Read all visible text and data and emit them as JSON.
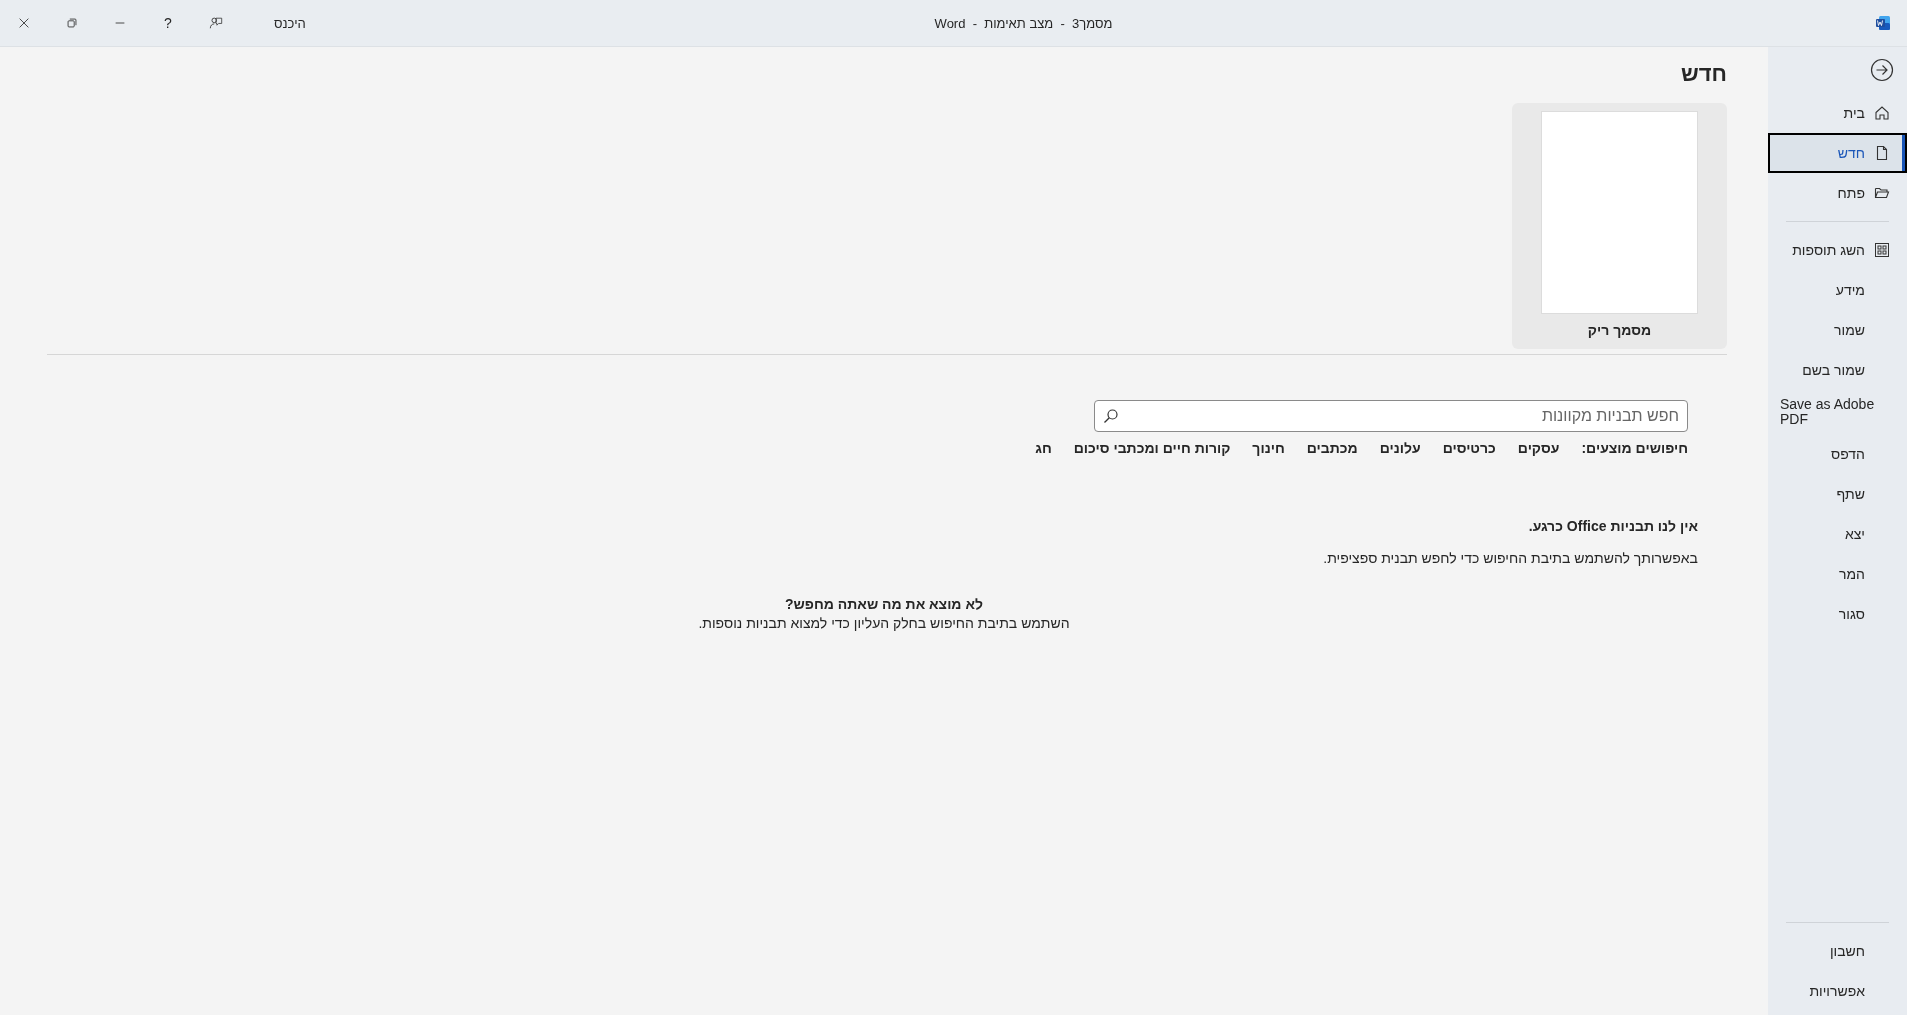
{
  "title_bar": {
    "title": "מסמך3  -  מצב תאימות  -  Word",
    "sign_in": "היכנס",
    "help": "?"
  },
  "sidebar": {
    "top_items": [
      {
        "label": "בית",
        "selected": false
      },
      {
        "label": "חדש",
        "selected": true
      },
      {
        "label": "פתח",
        "selected": false
      }
    ],
    "middle_items": [
      {
        "label": "השג תוספות",
        "selected": false
      },
      {
        "label": "מידע",
        "selected": false
      },
      {
        "label": "שמור",
        "selected": false
      },
      {
        "label": "שמור בשם",
        "selected": false
      },
      {
        "label": "Save as Adobe PDF",
        "selected": false
      },
      {
        "label": "הדפס",
        "selected": false
      },
      {
        "label": "שתף",
        "selected": false
      },
      {
        "label": "יצא",
        "selected": false
      },
      {
        "label": "המר",
        "selected": false
      },
      {
        "label": "סגור",
        "selected": false
      }
    ],
    "bottom_items": [
      {
        "label": "חשבון",
        "selected": false
      },
      {
        "label": "אפשרויות",
        "selected": false
      }
    ]
  },
  "main": {
    "heading": "חדש",
    "templates": [
      {
        "label": "מסמך ריק"
      }
    ],
    "search": {
      "placeholder": "חפש תבניות מקוונות"
    },
    "suggestions_label": "חיפושים מוצעים:",
    "suggestions": [
      "עסקים",
      "כרטיסים",
      "עלונים",
      "מכתבים",
      "חינוך",
      "קורות חיים ומכתבי סיכום",
      "חג"
    ],
    "notice_title": "אין לנו תבניות Office כרגע.",
    "notice_text": "באפשרותך להשתמש בתיבת החיפוש כדי לחפש תבנית ספציפית.",
    "help_title": "לא מוצא את מה שאתה מחפש?",
    "help_text": "השתמש בתיבת החיפוש בחלק העליון כדי למצוא תבניות נוספות."
  }
}
